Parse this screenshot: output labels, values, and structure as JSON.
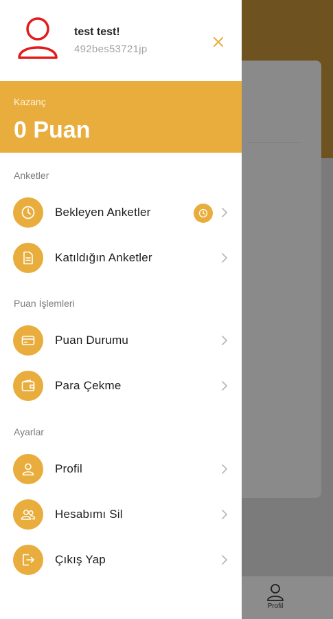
{
  "user": {
    "name": "test test!",
    "id": "492bes53721jp"
  },
  "earnings": {
    "label": "Kazanç",
    "value": "0 Puan"
  },
  "sections": {
    "surveys": "Anketler",
    "points": "Puan İşlemleri",
    "settings": "Ayarlar"
  },
  "menu": {
    "pending": "Bekleyen Anketler",
    "joined": "Katıldığın Anketler",
    "point_status": "Puan Durumu",
    "withdraw": "Para Çekme",
    "profile": "Profil",
    "delete_account": "Hesabımı Sil",
    "logout": "Çıkış Yap"
  },
  "bottom_nav": {
    "profile_label": "Profil"
  },
  "colors": {
    "accent": "#e8ad3c",
    "avatar_red": "#e31b1b"
  },
  "icons": [
    "user-avatar-icon",
    "close-icon",
    "clock-icon",
    "document-icon",
    "card-icon",
    "wallet-icon",
    "user-icon",
    "users-icon",
    "logout-icon",
    "chevron-right-icon"
  ]
}
